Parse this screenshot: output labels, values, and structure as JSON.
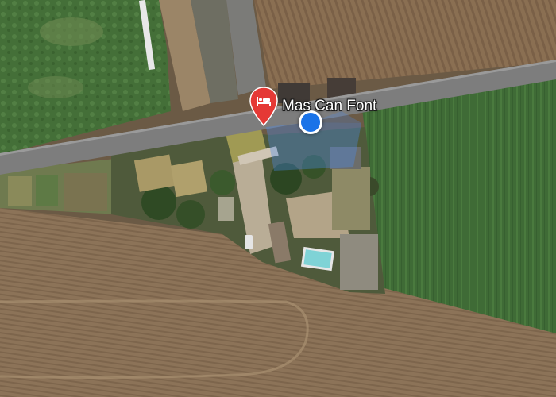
{
  "map": {
    "view": "satellite",
    "place": {
      "name": "Mas Can Font",
      "icon": "bed-icon",
      "marker_color": "#e53935"
    },
    "my_location": {
      "icon": "location-dot-icon",
      "color": "#1a73e8"
    }
  }
}
